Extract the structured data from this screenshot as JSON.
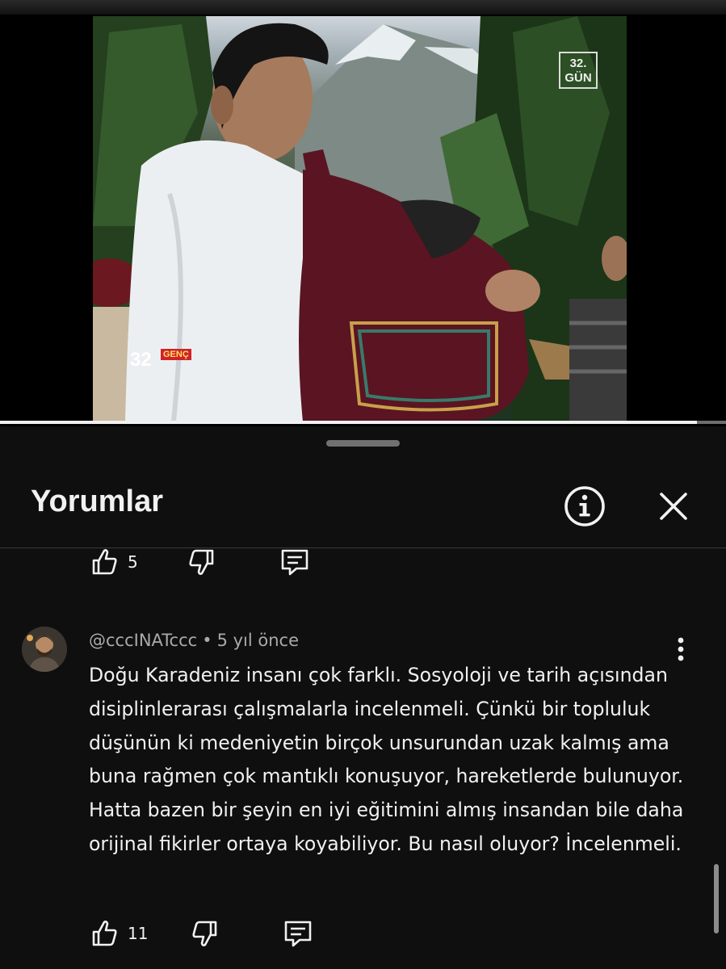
{
  "video": {
    "progress_fraction": 0.96,
    "watermark_top": "32.\nGÜN",
    "watermark_bottom_number": "32",
    "watermark_bottom_tag": "GENÇ"
  },
  "panel": {
    "title": "Yorumlar",
    "info_icon": "info-circle-icon",
    "close_icon": "close-icon"
  },
  "prev_comment_actions": {
    "like_count": "5"
  },
  "comment": {
    "author": "@cccINATccc",
    "separator": "•",
    "time": "5 yıl önce",
    "text": "Doğu Karadeniz insanı çok farklı. Sosyoloji ve tarih açısından disiplinlerarası çalışmalarla incelenmeli. Çünkü bir topluluk düşünün ki medeniyetin birçok unsurundan uzak kalmış ama buna rağmen çok mantıklı konuşuyor, hareketlerde bulunuyor. Hatta bazen bir şeyin en iyi eğitimini almış insandan bile daha orijinal fikirler ortaya koyabiliyor. Bu nasıl oluyor? İncelenmeli.",
    "like_count": "11"
  }
}
